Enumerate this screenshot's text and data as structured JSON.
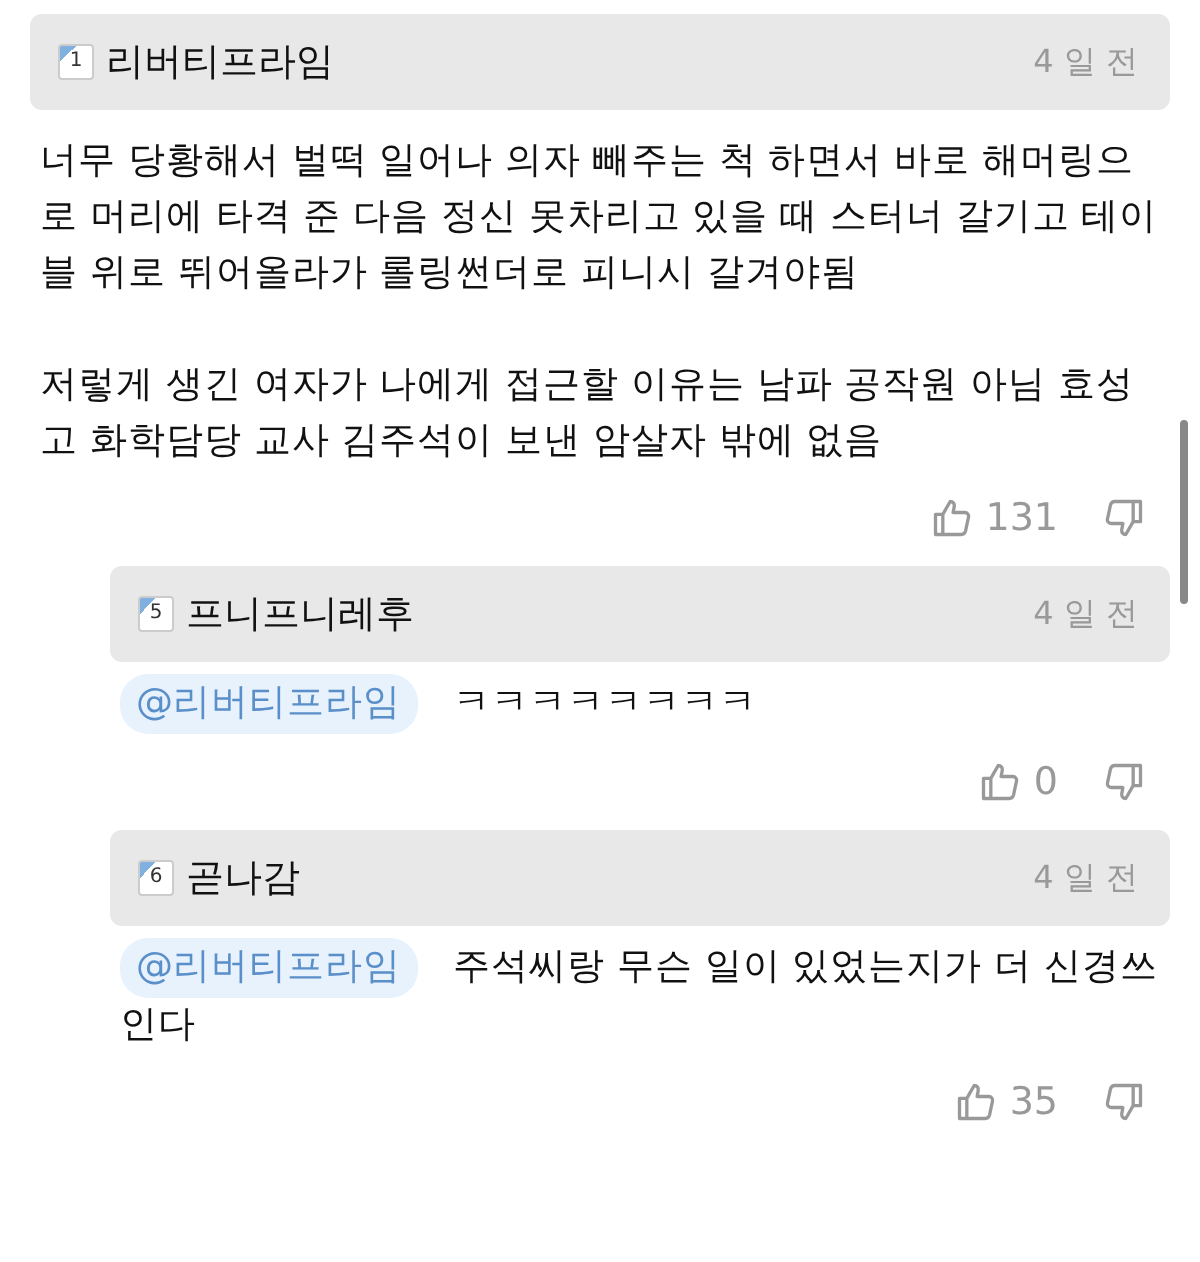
{
  "comments": [
    {
      "author": "리버티프라임",
      "level": "1",
      "time": "4 일 전",
      "paragraphs": [
        "너무 당황해서 벌떡 일어나 의자 빼주는 척 하면서 바로 해머링으로 머리에 타격 준 다음 정신 못차리고 있을 때 스터너 갈기고 테이블 위로 뛰어올라가 롤링썬더로 피니시 갈겨야됨",
        "저렇게 생긴 여자가 나에게 접근할 이유는 남파 공작원 아님 효성고 화학담당 교사 김주석이 보낸 암살자 밖에 없음"
      ],
      "likes": "131",
      "replies": [
        {
          "author": "프니프니레후",
          "level": "5",
          "time": "4 일 전",
          "mention": "@리버티프라임",
          "text": "ㅋㅋㅋㅋㅋㅋㅋㅋ",
          "likes": "0"
        },
        {
          "author": "곧나감",
          "level": "6",
          "time": "4 일 전",
          "mention": "@리버티프라임",
          "text": "주석씨랑 무슨 일이 있었는지가 더 신경쓰인다",
          "likes": "35"
        }
      ]
    }
  ]
}
